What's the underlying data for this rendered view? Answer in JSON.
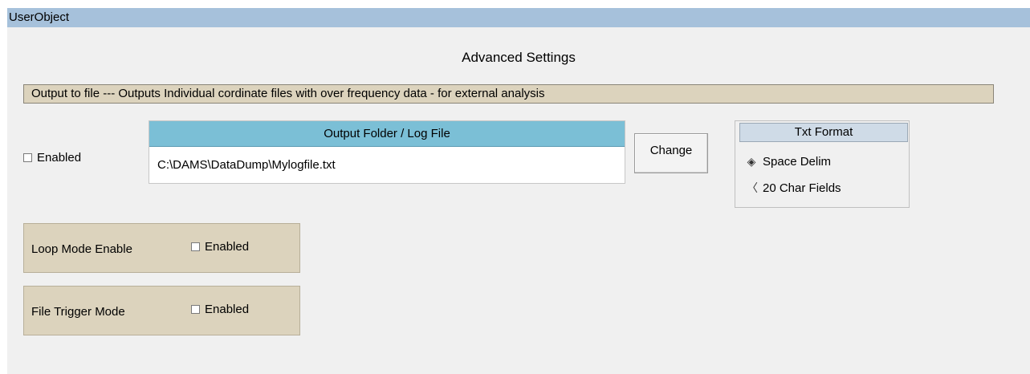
{
  "window": {
    "title": "UserObject"
  },
  "page": {
    "heading": "Advanced Settings",
    "banner": "Output to file --- Outputs Individual cordinate files with over frequency data -  for external analysis"
  },
  "output": {
    "enabled_label": "Enabled",
    "enabled_checked": false,
    "folder_header": "Output Folder / Log File",
    "folder_value": "C:\\DAMS\\DataDump\\Mylogfile.txt",
    "change_label": "Change"
  },
  "txt_format": {
    "header": "Txt Format",
    "options": [
      {
        "label": "Space Delim",
        "selected": true
      },
      {
        "label": "20 Char Fields",
        "selected": false
      }
    ]
  },
  "loop_mode": {
    "label": "Loop Mode Enable",
    "enabled_label": "Enabled",
    "enabled_checked": false
  },
  "file_trigger": {
    "label": "File Trigger Mode",
    "enabled_label": "Enabled",
    "enabled_checked": false
  },
  "colors": {
    "titlebar": "#a6c1db",
    "banner": "#dcd3bd",
    "folder_header": "#7bbfd6",
    "format_header": "#cfdbe7",
    "client": "#f0f0f0"
  }
}
